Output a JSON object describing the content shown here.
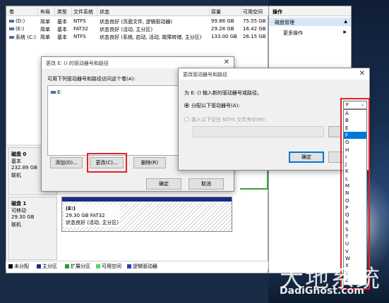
{
  "volumes": {
    "headers": [
      "卷",
      "布局",
      "类型",
      "文件系统",
      "状态",
      "容量",
      "可用空间"
    ],
    "rows": [
      [
        "(D:)",
        "简单",
        "基本",
        "NTFS",
        "状态良好 (页面文件, 逻辑驱动器)",
        "99.88 GB",
        "75.55 GB"
      ],
      [
        "(E:)",
        "简单",
        "基本",
        "FAT32",
        "状态良好 (活动, 主分区)",
        "29.28 GB",
        "16.42 GB"
      ],
      [
        "系统 (C:)",
        "简单",
        "基本",
        "NTFS",
        "状态良好 (系统, 启动, 活动, 故障转储, 主分区)",
        "133.00 GB",
        "26.15 GB"
      ]
    ]
  },
  "actions": {
    "title": "操作",
    "selected": "磁盘管理",
    "more": "更多操作"
  },
  "disks": [
    {
      "name": "磁盘 0",
      "type": "基本",
      "size": "232.89 GB",
      "status": "联机"
    },
    {
      "name": "磁盘 1",
      "type": "可移动",
      "size": "29.30 GB",
      "status": "联机"
    }
  ],
  "partition_e": {
    "label": "(E:)",
    "size": "29.30 GB FAT32",
    "status": "状态良好 (活动, 主分区)"
  },
  "legend": [
    {
      "label": "未分配",
      "color": "#000000"
    },
    {
      "label": "主分区",
      "color": "#1a2a8c"
    },
    {
      "label": "扩展分区",
      "color": "#2a9a2a"
    },
    {
      "label": "可用空间",
      "color": "#5fcf5f"
    },
    {
      "label": "逻辑驱动器",
      "color": "#2244cc"
    }
  ],
  "dialog1": {
    "title": "更改 E: () 的驱动器号和路径",
    "caption": "可用下列驱动器号和路径访问这个卷(A):",
    "list_item": "E:",
    "add": "添加(D)...",
    "change": "更改(C)...",
    "remove": "删除(R)",
    "ok": "确定",
    "cancel": "取消"
  },
  "dialog2": {
    "title": "更改驱动器号和路径",
    "caption": "为 E: () 输入新的驱动器号或路径。",
    "option1": "分配以下驱动器号(A):",
    "option2": "装入以下空白 NTFS 文件夹中(M):",
    "browse": "浏览(B)...",
    "ok": "确定",
    "cancel": "取消",
    "selected_letter": "F",
    "letters": [
      "A",
      "B",
      "E",
      "F",
      "G",
      "H",
      "I",
      "J",
      "K",
      "L",
      "M",
      "N",
      "O",
      "P",
      "Q",
      "R",
      "S",
      "T",
      "U",
      "V",
      "W",
      "X",
      "Y",
      "Z"
    ]
  },
  "watermark": {
    "big": "大地系统",
    "small": "DadiGhost.com"
  }
}
